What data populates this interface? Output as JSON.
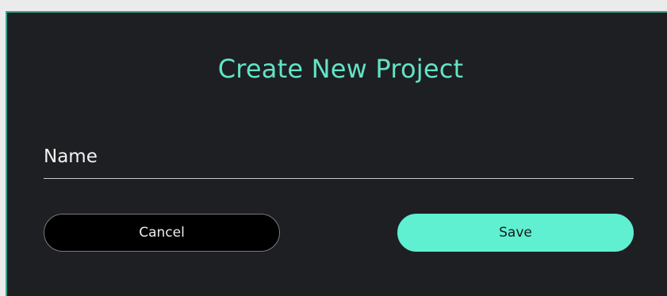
{
  "dialog": {
    "title": "Create New Project",
    "name_field": {
      "label": "Name",
      "value": ""
    },
    "buttons": {
      "cancel_label": "Cancel",
      "save_label": "Save"
    }
  },
  "colors": {
    "background": "#1e1f22",
    "accent": "#5ff0d1",
    "title": "#62e3c7",
    "border": "#3aa38c"
  }
}
